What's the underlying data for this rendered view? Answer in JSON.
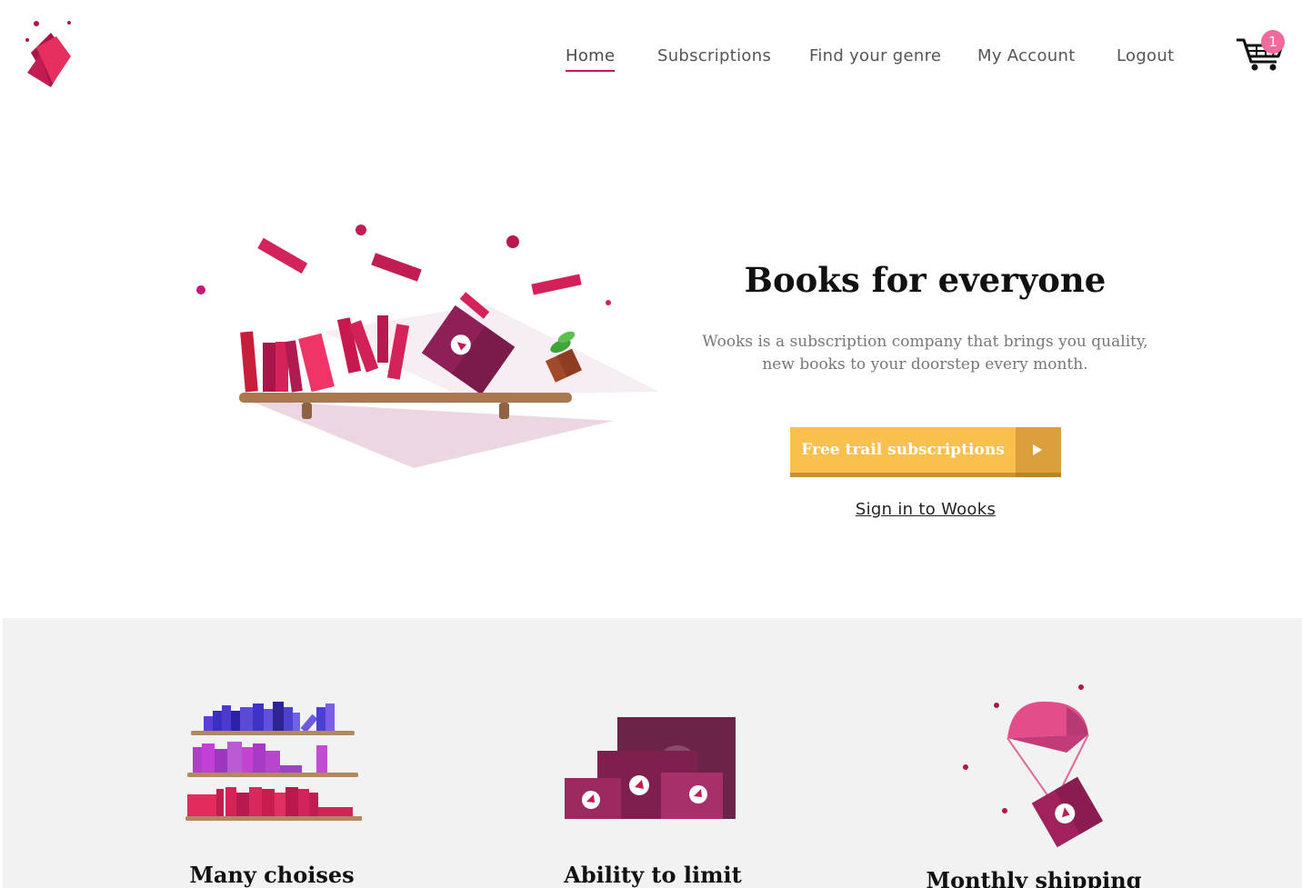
{
  "header": {
    "nav": [
      {
        "label": "Home",
        "active": true
      },
      {
        "label": "Subscriptions",
        "active": false
      },
      {
        "label": "Find your genre",
        "active": false
      },
      {
        "label": "My Account",
        "active": false
      },
      {
        "label": "Logout",
        "active": false
      }
    ],
    "cart": {
      "icon": "cart-icon",
      "count": "1"
    }
  },
  "hero": {
    "title": "Books for everyone",
    "description": "Wooks is a subscription company that brings you quality, new books to your doorstep every month.",
    "cta_label": "Free trail subscriptions",
    "cta_icon": "play-arrow-icon",
    "signin_label": "Sign in to Wooks"
  },
  "features": [
    {
      "title": "Many choises",
      "icon": "bookshelf-icon"
    },
    {
      "title": "Ability to limit",
      "icon": "boxes-icon"
    },
    {
      "title": "Monthly shipping",
      "icon": "parachute-box-icon"
    }
  ],
  "colors": {
    "accent": "#c8194f",
    "cta": "#f9c04d",
    "cta_dark": "#dba03b",
    "badge": "#f06b9c",
    "feature_bg": "#f2f2f2"
  }
}
